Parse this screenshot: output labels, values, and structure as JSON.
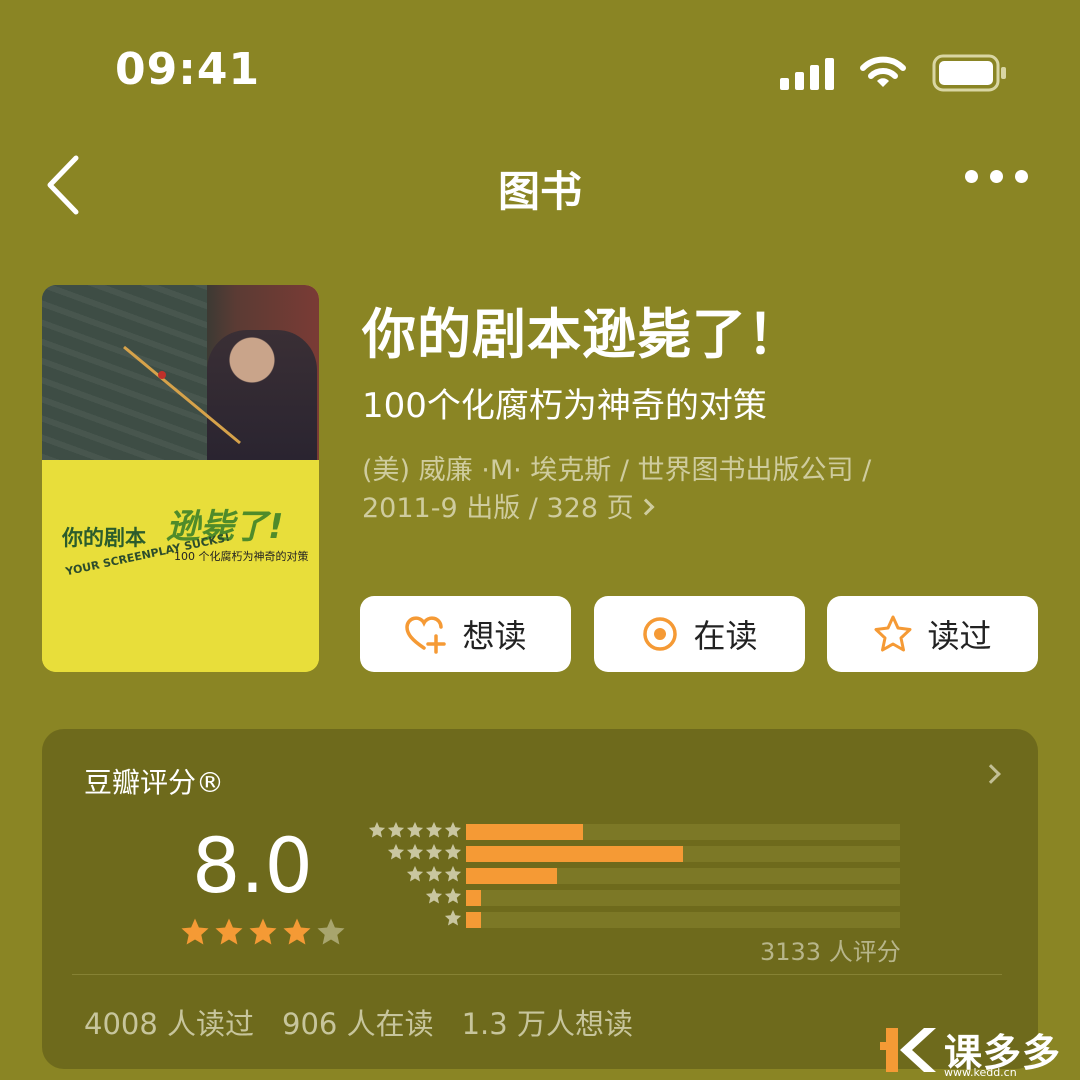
{
  "status_bar": {
    "time": "09:41"
  },
  "nav": {
    "title": "图书"
  },
  "cover": {
    "title_part1": "你的剧本",
    "title_part2": "逊毙了!",
    "subtitle": "100 个化腐朽为神奇的对策",
    "english": "YOUR SCREENPLAY SUCKS!"
  },
  "book": {
    "title": "你的剧本逊毙了！",
    "subtitle": "100个化腐朽为神奇的对策",
    "meta_line1": "(美) 威廉 ·M· 埃克斯 / 世界图书出版公司 /",
    "meta_line2": "2011-9 出版 / 328 页"
  },
  "actions": {
    "want": "想读",
    "reading": "在读",
    "read": "读过",
    "accent": "#f59a35"
  },
  "rating": {
    "label": "豆瓣评分®",
    "score": "8.0",
    "stars_filled": 4,
    "stars_total": 5,
    "count_text": "3133 人评分",
    "distribution": [
      {
        "stars": 5,
        "fraction": 0.27
      },
      {
        "stars": 4,
        "fraction": 0.5
      },
      {
        "stars": 3,
        "fraction": 0.21
      },
      {
        "stars": 2,
        "fraction": 0.035
      },
      {
        "stars": 1,
        "fraction": 0.035
      }
    ]
  },
  "stats": {
    "read": "4008 人读过",
    "reading": "906 人在读",
    "want": "1.3 万人想读"
  },
  "watermark": {
    "text": "课多多",
    "url": "www.kedd.cn"
  }
}
